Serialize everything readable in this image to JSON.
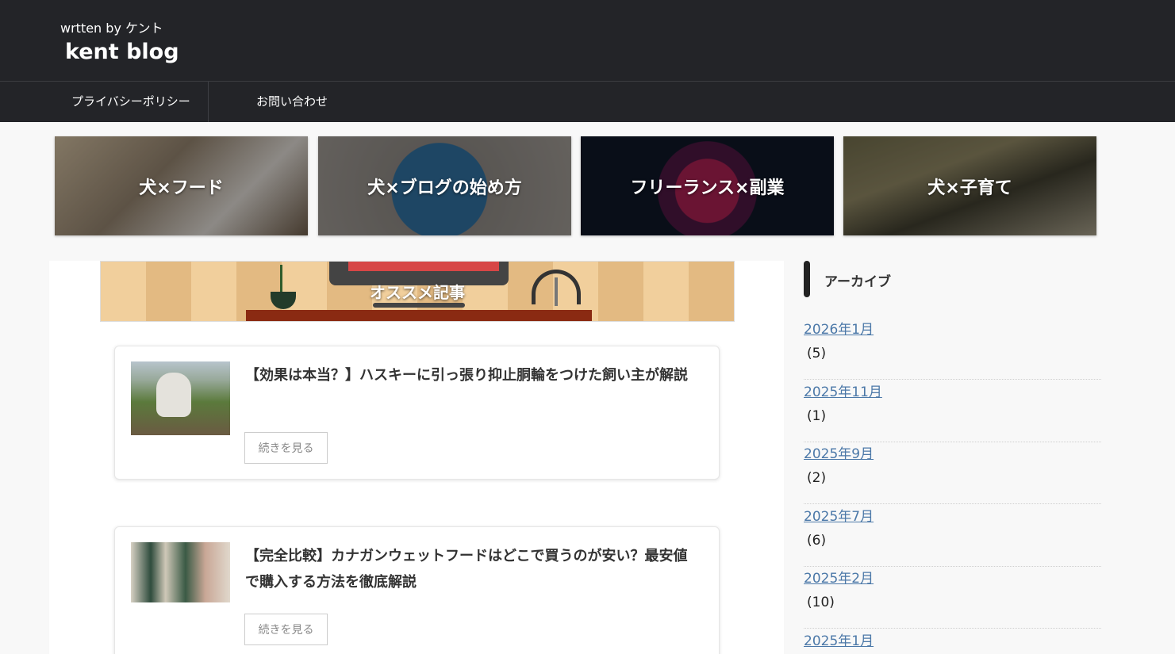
{
  "header": {
    "tagline": "wrtten by ケント",
    "site_title": "kent blog"
  },
  "nav": {
    "items": [
      {
        "label": "プライバシーポリシー"
      },
      {
        "label": "お問い合わせ"
      }
    ]
  },
  "categories": [
    {
      "label": "犬×フード"
    },
    {
      "label": "犬×ブログの始め方"
    },
    {
      "label": "フリーランス×副業"
    },
    {
      "label": "犬×子育て"
    }
  ],
  "banner": {
    "title": "オススメ記事"
  },
  "articles": [
    {
      "title": "【効果は本当？】ハスキーに引っ張り抑止胴輪をつけた飼い主が解説",
      "read_more": "続きを見る"
    },
    {
      "title": "【完全比較】カナガンウェットフードはどこで買うのが安い？最安値で購入する方法を徹底解説",
      "read_more": "続きを見る"
    }
  ],
  "sidebar": {
    "heading": "アーカイブ",
    "archives": [
      {
        "label": "2026年1月",
        "count": "(5)"
      },
      {
        "label": "2025年11月",
        "count": "(1)"
      },
      {
        "label": "2025年9月",
        "count": "(2)"
      },
      {
        "label": "2025年7月",
        "count": "(6)"
      },
      {
        "label": "2025年2月",
        "count": "(10)"
      },
      {
        "label": "2025年1月",
        "count": ""
      }
    ]
  },
  "colors": {
    "header_bg": "#232428",
    "link": "#4b78a8",
    "page_bg": "#f8f8f8"
  }
}
